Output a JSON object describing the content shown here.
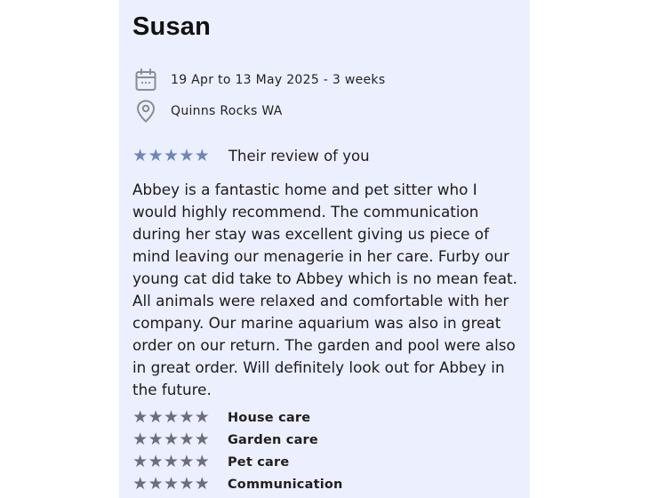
{
  "review": {
    "reviewer_name": "Susan",
    "dates": "19 Apr to 13 May 2025 - 3 weeks",
    "location": "Quinns Rocks WA",
    "overall_rating": 5,
    "heading": "Their review of you",
    "body": "Abbey is a fantastic home and pet sitter who I would highly recommend. The communication during her stay was excellent giving us piece of mind leaving our menagerie in her care. Furby our young cat did take to Abbey which is no mean feat. All animals were relaxed and comfortable with her company. Our marine aquarium was also in great order on our return. The garden and pool were also in great order. Will definitely look out for Abbey in the future.",
    "categories": [
      {
        "label": "House care",
        "rating": 5
      },
      {
        "label": "Garden care",
        "rating": 5
      },
      {
        "label": "Pet care",
        "rating": 5
      },
      {
        "label": "Communication",
        "rating": 5
      }
    ]
  },
  "icons": {
    "dates": "calendar-icon",
    "location": "location-pin-icon",
    "star": "star-icon"
  },
  "colors": {
    "card_background": "#eceffd",
    "overall_star": "#6f86b8",
    "category_star": "#6a6f7a",
    "icon": "#8a8c92"
  }
}
